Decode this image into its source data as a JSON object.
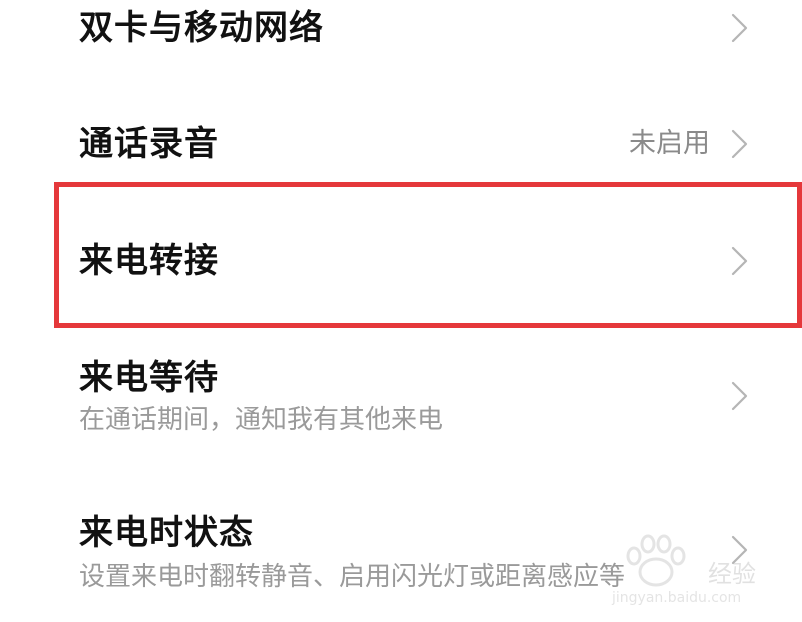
{
  "settings": {
    "items": [
      {
        "title": "双卡与移动网络",
        "chevron_icon": "chevron-right-icon"
      },
      {
        "title": "通话录音",
        "value": "未启用",
        "chevron_icon": "chevron-right-icon"
      },
      {
        "title": "来电转接",
        "chevron_icon": "chevron-right-icon"
      },
      {
        "title": "来电等待",
        "subtitle": "在通话期间，通知我有其他来电",
        "chevron_icon": "chevron-right-icon"
      },
      {
        "title": "来电时状态",
        "subtitle": "设置来电时翻转静音、启用闪光灯或距离感应等",
        "chevron_icon": "chevron-right-icon"
      }
    ]
  },
  "highlight": {
    "target": "来电转接",
    "color": "#e5383b"
  },
  "watermark": {
    "text": "经验",
    "url": "jingyan.baidu.com",
    "icon": "baidu-paw-icon"
  },
  "colors": {
    "title": "#111111",
    "secondary": "#9a9a9a",
    "chevron": "#b5b5b5"
  }
}
